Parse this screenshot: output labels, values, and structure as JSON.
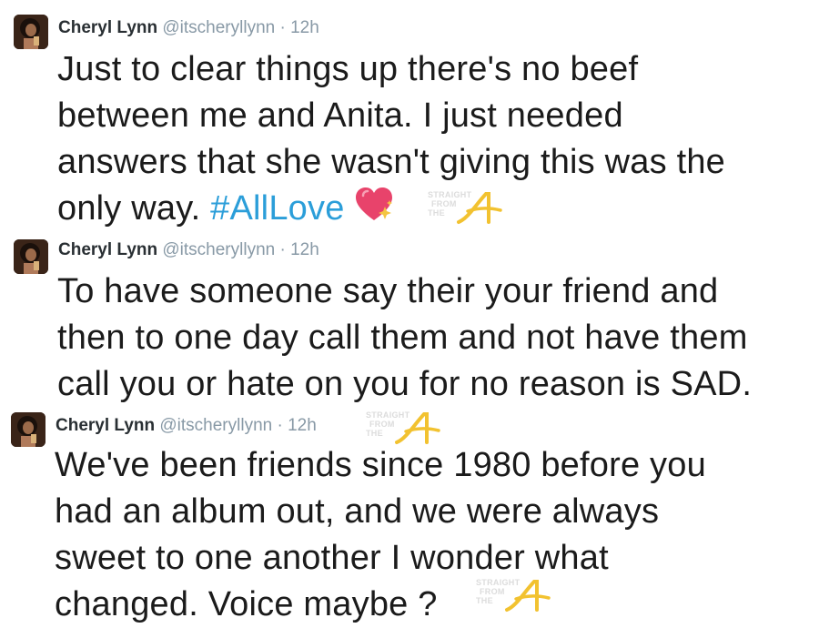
{
  "tweets": [
    {
      "name": "Cheryl Lynn",
      "handle": "@itscheryllynn",
      "separator": "·",
      "time": "12h",
      "lines": [
        "Just to clear things up there's no beef",
        "between me and Anita. I just needed",
        "answers that she wasn't giving this was the",
        "only way."
      ],
      "hashtag": "#AllLove",
      "emoji": "sparkling-heart-icon"
    },
    {
      "name": "Cheryl Lynn",
      "handle": "@itscheryllynn",
      "separator": "·",
      "time": "12h",
      "lines": [
        "To have someone say their your friend and",
        "then to one day call them and not have them",
        "call you or hate on you for no reason is SAD."
      ]
    },
    {
      "name": "Cheryl Lynn",
      "handle": "@itscheryllynn",
      "separator": "·",
      "time": "12h",
      "lines": [
        "We've been friends since 1980 before you",
        "had an album out, and we were always",
        "sweet to one another I wonder what",
        "changed. Voice maybe ?"
      ]
    }
  ],
  "watermark": {
    "lines": [
      "STRAIGHT",
      "FROM",
      "THE"
    ],
    "letter": "A",
    "letter_color": "#f2c230"
  },
  "colors": {
    "name": "#292f33",
    "meta": "#8899a6",
    "body": "#1b1b1b",
    "hashtag": "#2b9ed9",
    "heart": "#e8436b"
  }
}
